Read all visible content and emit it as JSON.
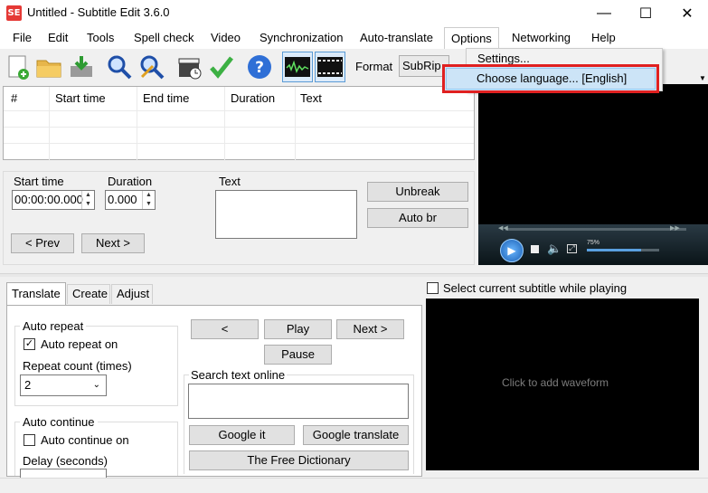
{
  "window": {
    "title": "Untitled - Subtitle Edit 3.6.0",
    "icon_text": "SE",
    "minimize": "—",
    "maximize": "☐",
    "close": "✕"
  },
  "menu": [
    "File",
    "Edit",
    "Tools",
    "Spell check",
    "Video",
    "Synchronization",
    "Auto-translate",
    "Options",
    "Networking",
    "Help"
  ],
  "options_menu": {
    "settings": "Settings...",
    "choose_language": "Choose language... [English]"
  },
  "toolbar": {
    "format_label": "Format",
    "format_value": "SubRip",
    "icons": [
      "new-file-icon",
      "open-folder-icon",
      "save-icon",
      "find-icon",
      "replace-icon",
      "visual-sync-icon",
      "spell-check-icon",
      "help-icon",
      "waveform-toggle-icon",
      "video-toggle-icon"
    ]
  },
  "grid": {
    "columns": [
      "#",
      "Start time",
      "End time",
      "Duration",
      "Text"
    ]
  },
  "edit": {
    "start_time_label": "Start time",
    "start_time_value": "00:00:00.000",
    "duration_label": "Duration",
    "duration_value": "0.000",
    "text_label": "Text",
    "unbreak": "Unbreak",
    "auto_br": "Auto br",
    "prev": "< Prev",
    "next": "Next >"
  },
  "video": {
    "volume_label": "75%"
  },
  "tabs": [
    "Translate",
    "Create",
    "Adjust"
  ],
  "translate": {
    "auto_repeat_group": "Auto repeat",
    "auto_repeat_on": "Auto repeat on",
    "repeat_count_label": "Repeat count (times)",
    "repeat_count_value": "2",
    "auto_continue_group": "Auto continue",
    "auto_continue_on": "Auto continue on",
    "delay_label": "Delay (seconds)",
    "prev_btn": "<",
    "play_btn": "Play",
    "next_btn": "Next >",
    "pause_btn": "Pause",
    "search_group": "Search text online",
    "google_it": "Google it",
    "google_translate": "Google translate",
    "free_dictionary": "The Free Dictionary"
  },
  "waveform": {
    "select_current": "Select current subtitle while playing",
    "click_to_add": "Click to add waveform"
  }
}
